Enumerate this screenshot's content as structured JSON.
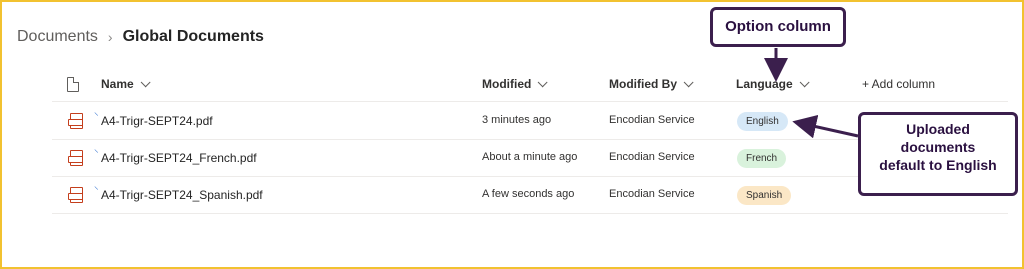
{
  "breadcrumb": {
    "root": "Documents",
    "separator": "›",
    "current": "Global Documents"
  },
  "columns": {
    "name": "Name",
    "modified": "Modified",
    "modified_by": "Modified By",
    "language": "Language",
    "add_column": "+ Add column"
  },
  "rows": [
    {
      "name": "A4-Trigr-SEPT24.pdf",
      "modified": "3 minutes ago",
      "modified_by": "Encodian Service",
      "language": "English"
    },
    {
      "name": "A4-Trigr-SEPT24_French.pdf",
      "modified": "About a minute ago",
      "modified_by": "Encodian Service",
      "language": "French"
    },
    {
      "name": "A4-Trigr-SEPT24_Spanish.pdf",
      "modified": "A few seconds ago",
      "modified_by": "Encodian Service",
      "language": "Spanish"
    }
  ],
  "colors": {
    "English": "#d6e8f7",
    "French": "#d9f2dc",
    "Spanish": "#fbe7c6",
    "frame_border": "#f2c230",
    "callout_border": "#3b1f4d"
  },
  "icons": {
    "file": "pdf-icon",
    "header": "document-icon",
    "new": "new-item-icon"
  },
  "callouts": {
    "option_column": "Option column",
    "uploaded_line1": "Uploaded",
    "uploaded_line2": "documents",
    "uploaded_line3": "default to English"
  }
}
